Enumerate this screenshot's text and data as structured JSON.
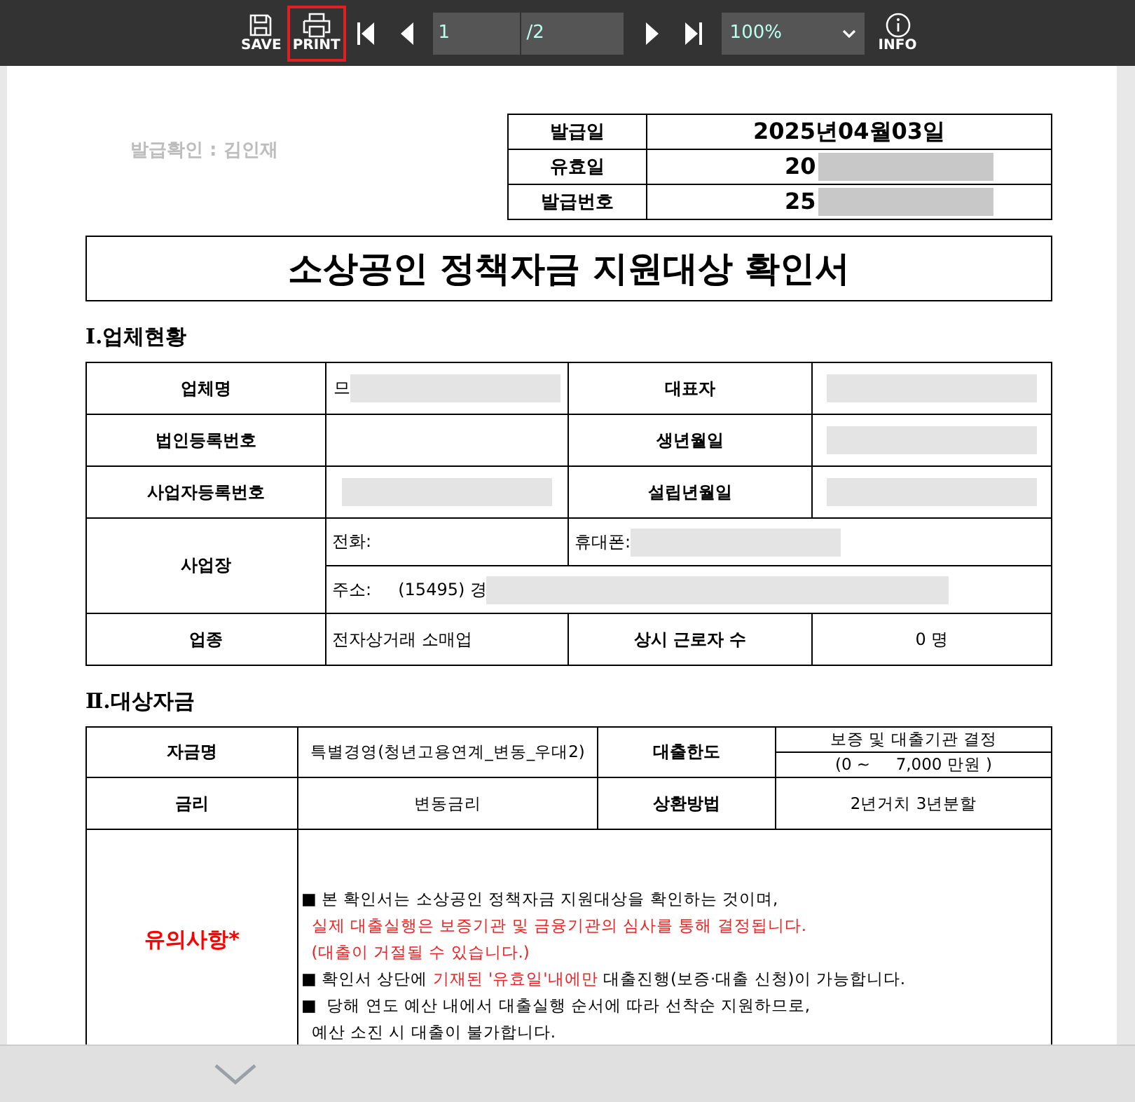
{
  "toolbar": {
    "buttons": [
      {
        "kind": "save",
        "label": "SAVE",
        "selected": false
      },
      {
        "kind": "print",
        "label": "PRINT",
        "selected": true
      }
    ],
    "page_input": {
      "value": "1"
    },
    "page_total": "/2",
    "zoom": {
      "value": "100%"
    },
    "info": {
      "label": "INFO"
    }
  },
  "document": {
    "issuer_note": "발급확인 : 김인재",
    "issue_table": [
      {
        "label": "발급일",
        "value": "2025년04월03일",
        "redacted": false
      },
      {
        "label": "유효일",
        "value": "20",
        "redacted": true
      },
      {
        "label": "발급번호",
        "value": "25",
        "redacted": true
      }
    ],
    "title": "소상공인 정책자금 지원대상 확인서",
    "section1": {
      "heading": "Ⅰ.업체현황",
      "rows": [
        {
          "label": "업체명",
          "value": "므",
          "redacted": true,
          "label2": "대표자",
          "value2": "",
          "redacted2": true
        },
        {
          "label": "법인등록번호",
          "value": "",
          "redacted": false,
          "label2": "생년월일",
          "value2": "",
          "redacted2": true
        },
        {
          "label": "사업자등록번호",
          "value": "",
          "redacted": true,
          "label2": "설립년월일",
          "value2": "",
          "redacted2": true
        }
      ],
      "site": {
        "label": "사업장",
        "phone_label": "전화:",
        "mobile_label": "휴대폰:",
        "mobile_redacted": true,
        "address_label": "주소:",
        "address": "(15495) 경",
        "address_redacted": true
      },
      "industry": {
        "label": "업종",
        "value": "전자상거래 소매업",
        "label2": "상시 근로자 수",
        "value2": "0 명"
      }
    },
    "section2": {
      "heading": "Ⅱ.대상자금",
      "fund_label": "자금명",
      "fund": "특별경영(청년고용연계_변동_우대2)",
      "limit_label": "대출한도",
      "limit_line1": "보증 및 대출기관 결정",
      "limit_line2": "(0 ~     7,000 만원 )",
      "rate_label": "금리",
      "rate": "변동금리",
      "repay_label": "상환방법",
      "repay": "2년거치 3년분할",
      "notes_label": "유의사항*",
      "notes": [
        [
          {
            "text": "■ 본 확인서는 소상공인 정책자금 지원대상을 확인하는 것이며,",
            "highlight": false
          }
        ],
        [
          {
            "text": "  실제 대출실행은 보증기관 및 금융기관의 심사를 통해 결정됩니다.",
            "highlight": true
          }
        ],
        [
          {
            "text": "  (대출이 거절될 수 있습니다.)",
            "highlight": true
          }
        ],
        [
          {
            "text": "■ 확인서 상단에 ",
            "highlight": false
          },
          {
            "text": "기재된 '유효일'내에만",
            "highlight": true
          },
          {
            "text": " 대출진행(보증·대출 신청)이 가능합니다.",
            "highlight": false
          }
        ],
        [
          {
            "text": "■  당해 연도 예산 내에서 대출실행 순서에 따라 선착순 지원하므로,",
            "highlight": false
          }
        ],
        [
          {
            "text": "  예산 소진 시 대출이 불가합니다.",
            "highlight": false
          }
        ]
      ]
    }
  }
}
